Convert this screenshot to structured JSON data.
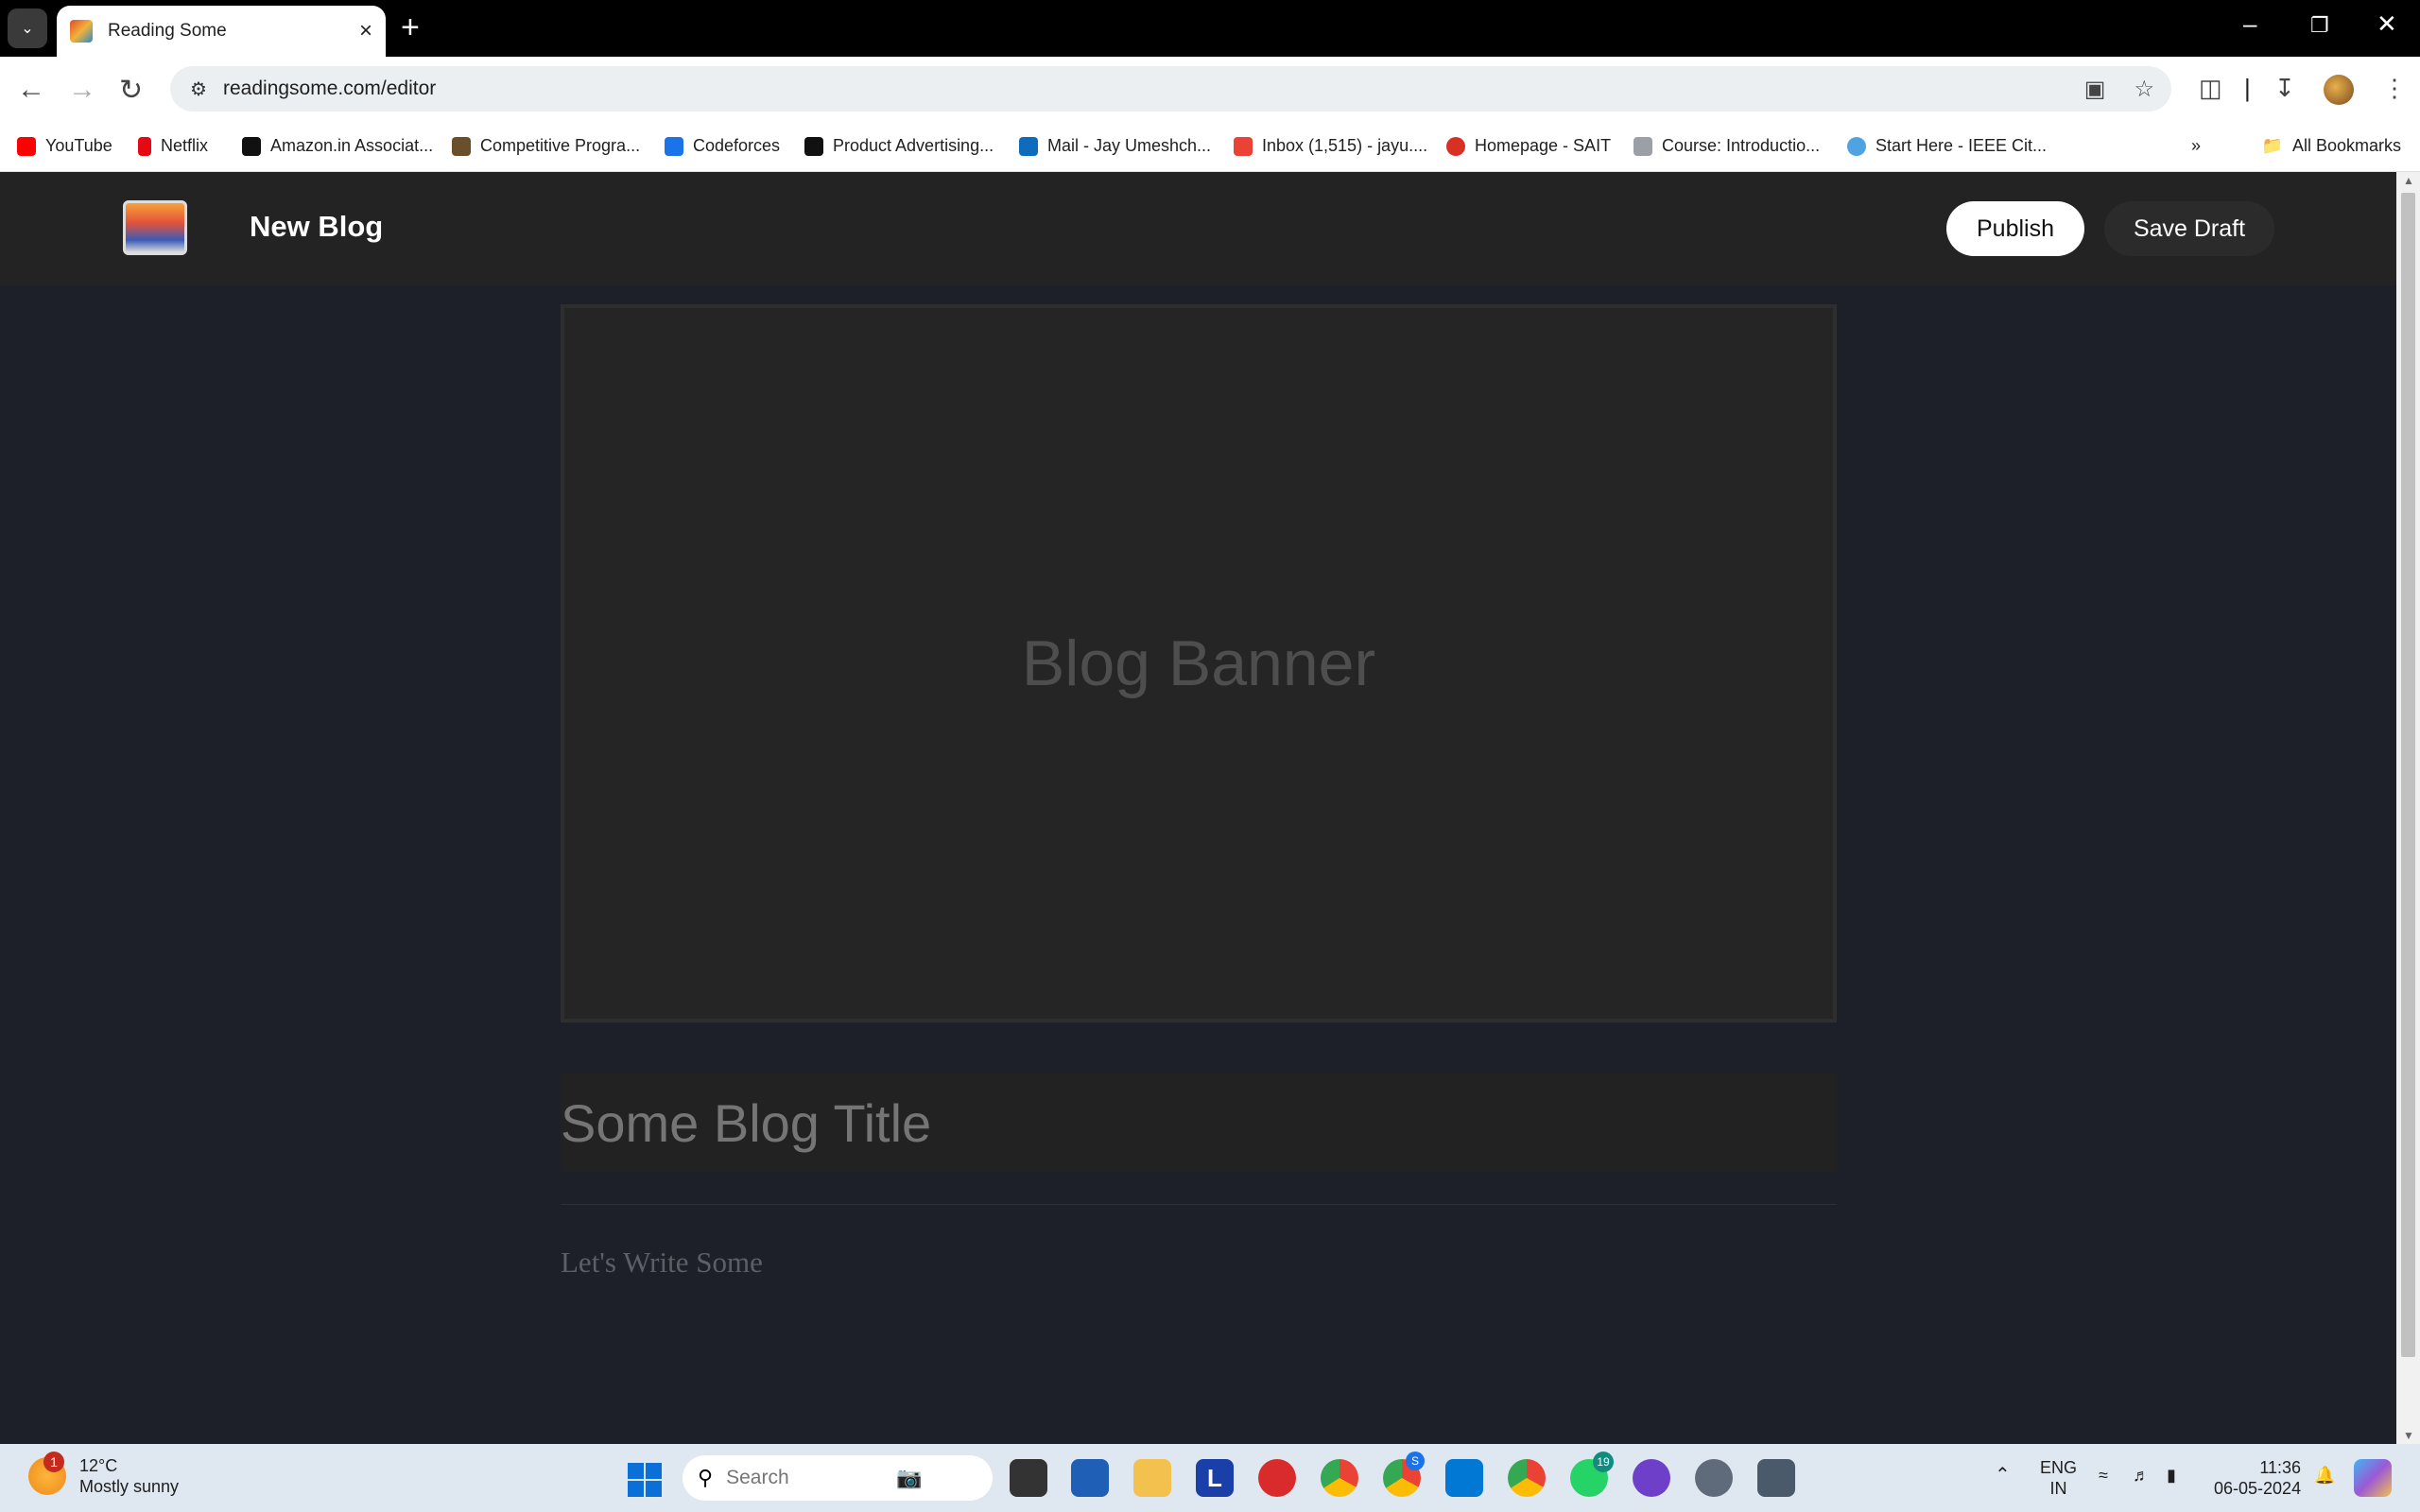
{
  "browser": {
    "tab_title": "Reading Some",
    "url": "readingsome.com/editor"
  },
  "bookmarks": [
    {
      "label": "YouTube",
      "color": "#ff0000"
    },
    {
      "label": "Netflix",
      "color": "#e50914"
    },
    {
      "label": "Amazon.in Associat...",
      "color": "#111111"
    },
    {
      "label": "Competitive Progra...",
      "color": "#6b4f2a"
    },
    {
      "label": "Codeforces",
      "color": "#1a73e8"
    },
    {
      "label": "Product Advertising...",
      "color": "#111111"
    },
    {
      "label": "Mail - Jay Umeshch...",
      "color": "#0f6cbd"
    },
    {
      "label": "Inbox (1,515) - jayu....",
      "color": "#ea4335"
    },
    {
      "label": "Homepage - SAIT",
      "color": "#d93025"
    },
    {
      "label": "Course: Introductio...",
      "color": "#9aa0a6"
    },
    {
      "label": "Start Here - IEEE Cit...",
      "color": "#4fa3e0"
    }
  ],
  "all_bookmarks": "All Bookmarks",
  "app": {
    "title": "New Blog",
    "publish": "Publish",
    "save_draft": "Save Draft",
    "banner_text": "Blog Banner",
    "title_placeholder": "Some Blog Title",
    "body_placeholder": "Let's Write Some"
  },
  "taskbar": {
    "weather_badge": "1",
    "temperature": "12°C",
    "weather_desc": "Mostly sunny",
    "search_placeholder": "Search",
    "whatsapp_badge": "19",
    "chrome_badge": "S",
    "lang_top": "ENG",
    "lang_bottom": "IN",
    "time": "11:36",
    "date": "06-05-2024"
  }
}
